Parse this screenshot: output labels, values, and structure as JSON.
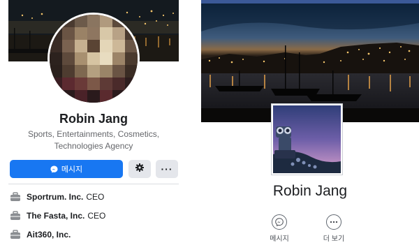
{
  "left_profile": {
    "name": "Robin Jang",
    "bio": "Sports, Entertainments, Cosmetics, Technologies Agency",
    "message_button_label": "메시지",
    "more_button_label": "···",
    "work": [
      {
        "company": "Sportrum. Inc.",
        "role": "CEO"
      },
      {
        "company": "The Fasta, Inc.",
        "role": "CEO"
      },
      {
        "company": "Ait360, Inc.",
        "role": ""
      }
    ]
  },
  "right_profile": {
    "name": "Robin Jang",
    "actions": [
      {
        "label": "메시지",
        "icon": "messenger-icon"
      },
      {
        "label": "더 보기",
        "icon": "more-icon"
      }
    ]
  },
  "colors": {
    "brand_blue": "#1877f2",
    "classic_blue": "#3b5998",
    "button_gray": "#e4e6eb"
  }
}
